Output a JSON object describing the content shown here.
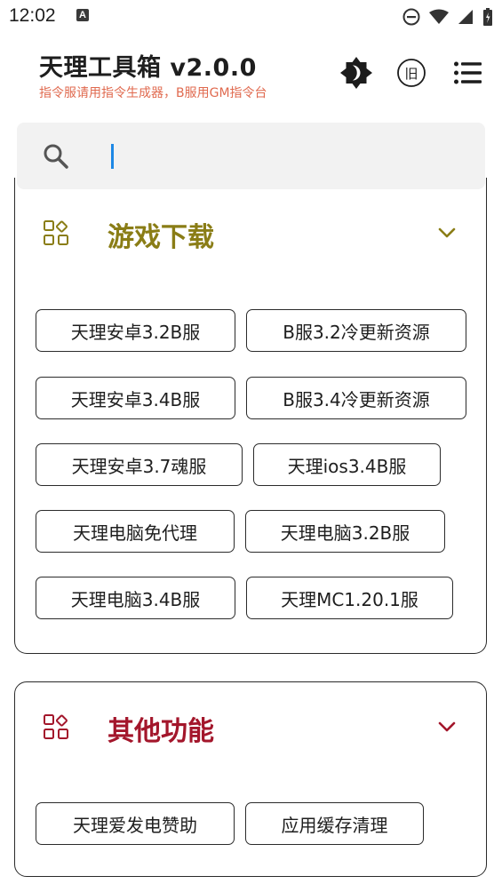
{
  "status_bar": {
    "time": "12:02",
    "notification_letter": "A",
    "icons": [
      "a-notification-icon",
      "do-not-disturb-icon",
      "wifi-icon",
      "signal-icon",
      "battery-icon"
    ]
  },
  "header": {
    "title": "天理工具箱 v2.0.0",
    "subtitle": "指令服请用指令生成器，B服用GM指令台",
    "old_version_label": "旧",
    "actions": [
      "theme-toggle-icon",
      "old-version-icon",
      "menu-icon"
    ]
  },
  "search": {
    "value": "",
    "placeholder": ""
  },
  "sections": [
    {
      "title": "游戏下载",
      "accent": "#8a7d16",
      "expanded": true,
      "buttons": [
        "天理安卓3.2B服",
        "B服3.2冷更新资源",
        "天理安卓3.4B服",
        "B服3.4冷更新资源",
        "天理安卓3.7魂服",
        "天理ios3.4B服",
        "天理电脑免代理",
        "天理电脑3.2B服",
        "天理电脑3.4B服",
        "天理MC1.20.1服"
      ]
    },
    {
      "title": "其他功能",
      "accent": "#a3162b",
      "expanded": true,
      "buttons": [
        "天理爱发电赞助",
        "应用缓存清理"
      ]
    }
  ],
  "colors": {
    "subtitle": "#e06a4f",
    "cursor": "#1e88e5",
    "search_bg": "#f2f2f2"
  }
}
